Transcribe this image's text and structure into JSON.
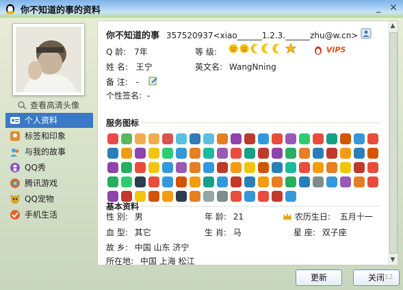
{
  "window": {
    "title": "你不知道的事的资料",
    "controls": {
      "minimize": "_",
      "close": "×"
    }
  },
  "sidebar": {
    "hd_link": "查看高清头像",
    "items": [
      {
        "label": "个人资料",
        "icon": "id-card-icon",
        "color": "#3b79c6"
      },
      {
        "label": "标签和印象",
        "icon": "tag-icon",
        "color": "#e58a2b"
      },
      {
        "label": "与我的故事",
        "icon": "people-icon",
        "color": "#4aa0d8"
      },
      {
        "label": "QQ秀",
        "icon": "qq-show-icon",
        "color": "#8a56c6"
      },
      {
        "label": "腾讯游戏",
        "icon": "game-icon",
        "color": "#e0642b"
      },
      {
        "label": "QQ宠物",
        "icon": "pet-icon",
        "color": "#d8a232"
      },
      {
        "label": "手机生活",
        "icon": "phone-check-icon",
        "color": "#e8602a"
      }
    ]
  },
  "profile": {
    "nickname": "你不知道的事",
    "qq_id_email": "357520937<xiao______1.2.3.______zhu@w.cn>",
    "qage_label": "Q   龄:",
    "qage_value": "7年",
    "level_label": "等   级:",
    "name_label": "姓   名:",
    "name_value": "王宁",
    "en_name_label": "英文名:",
    "en_name_value": "WangNning",
    "note_label": "备   注:",
    "note_value": "-",
    "signature_label": "个性签名:",
    "signature_value": "-",
    "vip_badge": "VIP5"
  },
  "services": {
    "heading": "服务图标",
    "icon_colors": [
      "#e84a4a",
      "#5cb85c",
      "#f0ad4e",
      "#f0ad4e",
      "#d9534f",
      "#5bc0de",
      "#337ab7",
      "#5bc0de",
      "#e67e22",
      "#8e44ad",
      "#c0392b",
      "#3498db",
      "#e74c3c",
      "#9b59b6",
      "#2ecc71",
      "#e74c3c",
      "#16a085",
      "#d35400",
      "#3498db",
      "#e74c3c",
      "#2980b9",
      "#f39c12",
      "#8e44ad",
      "#f1c40f",
      "#2ecc71",
      "#3498db",
      "#e67e22",
      "#1abc9c",
      "#9b59b6",
      "#e74c3c",
      "#16a085",
      "#c0392b",
      "#8e44ad",
      "#27ae60",
      "#e67e22",
      "#2980b9",
      "#c0392b",
      "#f39c12",
      "#2980b9",
      "#d35400",
      "#8e44ad",
      "#27ae60",
      "#e74c3c",
      "#f1c40f",
      "#3498db",
      "#9b59b6",
      "#e67e22",
      "#3498db",
      "#c0392b",
      "#f39c12",
      "#f1c40f",
      "#d35400",
      "#2980b9",
      "#1abc9c",
      "#e74c3c",
      "#f39c12",
      "#e67e22",
      "#f1c40f",
      "#c0392b",
      "#e74c3c",
      "#27ae60",
      "#2ecc71",
      "#2c3e50",
      "#e74c3c",
      "#3498db",
      "#d35400",
      "#f39c12",
      "#16a085",
      "#3498db",
      "#c0392b",
      "#2980b9",
      "#f39c12",
      "#e67e22",
      "#27ae60",
      "#2980b9",
      "#7f8c8d",
      "#3498db",
      "#9b59b6",
      "#e67e22",
      "#e74c3c",
      "#8e44ad",
      "#c0392b",
      "#f1c40f",
      "#d35400",
      "#f39c12",
      "#2c3e50",
      "#e67e22",
      "#95a5a6",
      "#7f8c8d",
      "#e74c3c",
      "#3498db",
      "#e74c3c",
      "#c0392b",
      "#3498db"
    ]
  },
  "basic": {
    "heading": "基本资料",
    "rows": [
      [
        {
          "label": "性   别:",
          "value": "男"
        },
        {
          "label": "年   龄:",
          "value": "21"
        },
        {
          "label": "农历生日:",
          "value": "五月十一"
        }
      ],
      [
        {
          "label": "血   型:",
          "value": "其它"
        },
        {
          "label": "生   肖:",
          "value": "马"
        },
        {
          "label": "星     座:",
          "value": "双子座"
        }
      ],
      [
        {
          "label": "故   乡:",
          "value": "中国 山东 济宁"
        }
      ],
      [
        {
          "label": "所在地:",
          "value": "中国 上海 松江"
        }
      ]
    ]
  },
  "buttons": {
    "refresh": "更新",
    "close": "关闭"
  },
  "page_indicator": "1/12"
}
